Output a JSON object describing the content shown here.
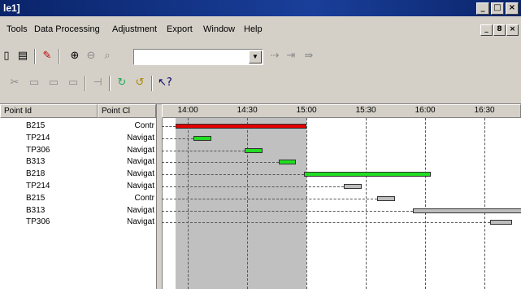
{
  "window": {
    "title": "le1]"
  },
  "window_buttons": [
    "_",
    "□",
    "×"
  ],
  "mdi_buttons": [
    "_",
    "8",
    "×"
  ],
  "menu": [
    {
      "label": "Tools"
    },
    {
      "label": "Data Processing"
    },
    {
      "label": "Adjustment"
    },
    {
      "label": "Export"
    },
    {
      "label": "Window"
    },
    {
      "label": "Help"
    }
  ],
  "toolbar1": {
    "icons": [
      "open-icon",
      "save-icon",
      "settings-icon",
      "zoom-in-icon",
      "zoom-out-icon",
      "zoom-icon",
      "next-icon",
      "forward-icon",
      "last-icon"
    ],
    "combo_value": ""
  },
  "toolbar2": {
    "icons": [
      "tool-icon",
      "panel-icon",
      "panel2-icon",
      "window-icon",
      "split-icon",
      "refresh-icon",
      "refresh2-icon",
      "whats-this-icon"
    ]
  },
  "table": {
    "headers": [
      "Point Id",
      "Point Cl"
    ],
    "rows": [
      {
        "id": "B215",
        "type": "Contr"
      },
      {
        "id": "TP214",
        "type": "Navigat"
      },
      {
        "id": "TP306",
        "type": "Navigat"
      },
      {
        "id": "B313",
        "type": "Navigat"
      },
      {
        "id": "B218",
        "type": "Navigat"
      },
      {
        "id": "TP214",
        "type": "Navigat"
      },
      {
        "id": "B215",
        "type": "Contr"
      },
      {
        "id": "B313",
        "type": "Navigat"
      },
      {
        "id": "TP306",
        "type": "Navigat"
      }
    ]
  },
  "timeline": {
    "ticks": [
      "14:00",
      "14:30",
      "15:00",
      "15:30",
      "16:00",
      "16:30"
    ],
    "selection": {
      "start": "13:54",
      "end": "15:00"
    },
    "bars": [
      {
        "row": 0,
        "start": "13:54",
        "end": "15:00",
        "color": "#e00000"
      },
      {
        "row": 1,
        "start": "14:03",
        "end": "14:12",
        "color": "#22dd22"
      },
      {
        "row": 2,
        "start": "14:29",
        "end": "14:38",
        "color": "#22dd22"
      },
      {
        "row": 3,
        "start": "14:46",
        "end": "14:55",
        "color": "#22dd22"
      },
      {
        "row": 4,
        "start": "14:59",
        "end": "16:03",
        "color": "#22dd22"
      },
      {
        "row": 5,
        "start": "15:19",
        "end": "15:28",
        "color": "#bdbdbd"
      },
      {
        "row": 6,
        "start": "15:36",
        "end": "15:45",
        "color": "#bdbdbd"
      },
      {
        "row": 7,
        "start": "15:54",
        "end": "16:51",
        "color": "#bdbdbd"
      },
      {
        "row": 8,
        "start": "16:33",
        "end": "16:44",
        "color": "#bdbdbd"
      }
    ]
  }
}
